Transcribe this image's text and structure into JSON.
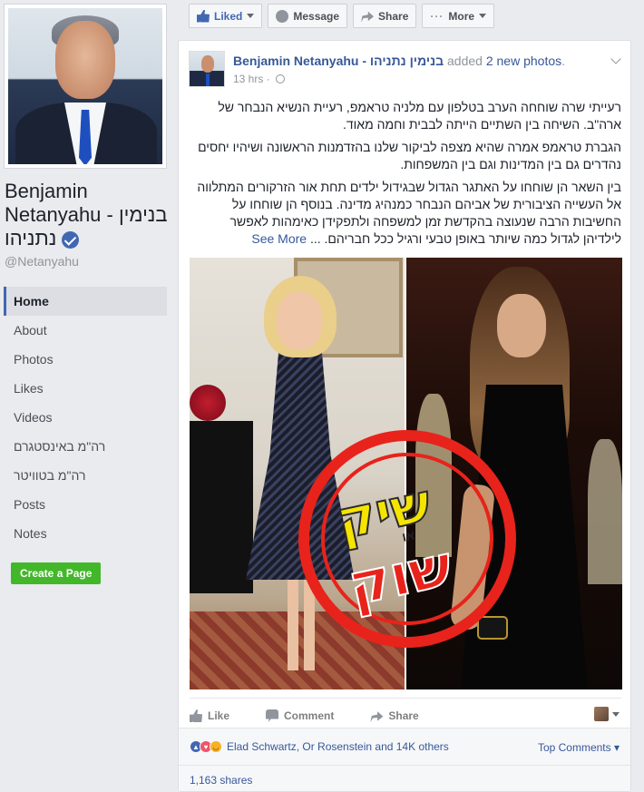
{
  "sidebar": {
    "page_name": "Benjamin Netanyahu - בנימין נתניהו",
    "handle": "@Netanyahu",
    "nav": [
      {
        "label": "Home",
        "active": true
      },
      {
        "label": "About"
      },
      {
        "label": "Photos"
      },
      {
        "label": "Likes"
      },
      {
        "label": "Videos"
      },
      {
        "label": "רה\"מ באינסטגרם"
      },
      {
        "label": "רה\"מ בטוויטר"
      },
      {
        "label": "Posts"
      },
      {
        "label": "Notes"
      }
    ],
    "create_page": "Create a Page"
  },
  "action_bar": {
    "liked": "Liked",
    "message": "Message",
    "share": "Share",
    "more": "More"
  },
  "post": {
    "author": "Benjamin Netanyahu - בנימין נתניהו",
    "action": "added",
    "photos_link": "2 new photos",
    "time": "13 hrs",
    "paragraphs": [
      "רעייתי שרה שוחחה הערב בטלפון עם מלניה טראמפ, רעיית הנשיא הנבחר של ארה\"ב. השיחה בין השתיים הייתה לבבית וחמה מאוד.",
      "הגברת טראמפ אמרה שהיא מצפה לביקור שלנו בהזדמנות הראשונה ושיהיו יחסים נהדרים גם בין המדינות וגם בין המשפחות.",
      "בין השאר הן שוחחו על האתגר הגדול שבגידול ילדים תחת אור הזרקורים המתלווה אל העשייה הציבורית של אביהם הנבחר כמנהיג מדינה. בנוסף הן שוחחו על החשיבות הרבה שנעוצה בהקדשת זמן למשפחה ולתפקידן כאימהות לאפשר לילדיהן לגדול כמה שיותר באופן טבעי ורגיל ככל חבריהם. ..."
    ],
    "see_more": "See More",
    "stamp": {
      "word1": "שיק",
      "word2": "שוק",
      "small": "או"
    },
    "actions": {
      "like": "Like",
      "comment": "Comment",
      "share": "Share"
    },
    "reactions_text": "Elad Schwartz, Or Rosenstein and 14K others",
    "top_comments": "Top Comments",
    "shares": "1,163 shares"
  },
  "colors": {
    "link": "#365899",
    "brand": "#4267b2",
    "create_green": "#42b72a",
    "stamp_red": "#e8231b"
  }
}
